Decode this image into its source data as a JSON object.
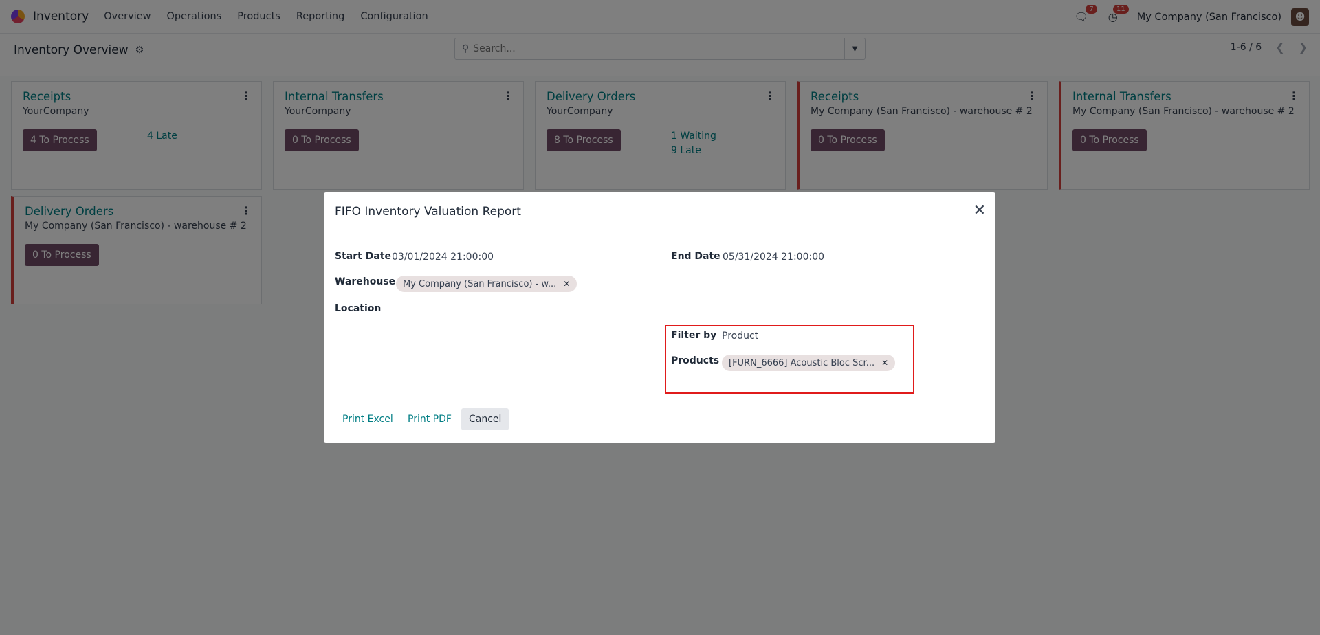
{
  "navbar": {
    "app_name": "Inventory",
    "menu": [
      "Overview",
      "Operations",
      "Products",
      "Reporting",
      "Configuration"
    ],
    "messages_count": "7",
    "activities_count": "11",
    "company": "My Company (San Francisco)"
  },
  "control": {
    "title": "Inventory Overview",
    "search_placeholder": "Search...",
    "pager": "1-6 / 6"
  },
  "cards": [
    {
      "title": "Receipts",
      "subtitle": "YourCompany",
      "button": "4 To Process",
      "stats": [
        "4 Late"
      ],
      "flag": false
    },
    {
      "title": "Internal Transfers",
      "subtitle": "YourCompany",
      "button": "0 To Process",
      "stats": [],
      "flag": false
    },
    {
      "title": "Delivery Orders",
      "subtitle": "YourCompany",
      "button": "8 To Process",
      "stats": [
        "1 Waiting",
        "9 Late"
      ],
      "flag": false
    },
    {
      "title": "Receipts",
      "subtitle": "My Company (San Francisco) - warehouse # 2",
      "button": "0 To Process",
      "stats": [],
      "flag": true
    },
    {
      "title": "Internal Transfers",
      "subtitle": "My Company (San Francisco) - warehouse # 2",
      "button": "0 To Process",
      "stats": [],
      "flag": true
    },
    {
      "title": "Delivery Orders",
      "subtitle": "My Company (San Francisco) - warehouse # 2",
      "button": "0 To Process",
      "stats": [],
      "flag": true
    }
  ],
  "dialog": {
    "title": "FIFO Inventory Valuation Report",
    "start_date_label": "Start Date",
    "start_date": "03/01/2024 21:00:00",
    "end_date_label": "End Date",
    "end_date": "05/31/2024 21:00:00",
    "warehouse_label": "Warehouse",
    "warehouse_tag": "My Company (San Francisco) - w...",
    "location_label": "Location",
    "filter_by_label": "Filter by",
    "filter_by": "Product",
    "products_label": "Products",
    "product_tag": "[FURN_6666] Acoustic Bloc Scr...",
    "print_excel": "Print Excel",
    "print_pdf": "Print PDF",
    "cancel": "Cancel"
  },
  "colors": {
    "primary": "#714b67",
    "link": "#017e84",
    "danger": "#d23f3a",
    "highlight": "#e01b1b"
  }
}
